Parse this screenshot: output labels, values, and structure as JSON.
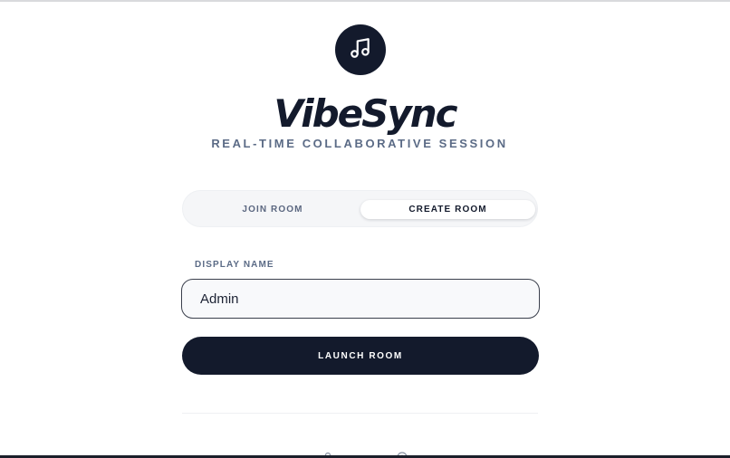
{
  "app": {
    "name": "VibeSync",
    "tagline": "REAL-TIME COLLABORATIVE SESSION",
    "logo_icon": "music-note-icon"
  },
  "tabs": [
    {
      "label": "JOIN ROOM",
      "active": false
    },
    {
      "label": "CREATE ROOM",
      "active": true
    }
  ],
  "form": {
    "display_name_label": "DISPLAY NAME",
    "display_name_value": "Admin"
  },
  "actions": {
    "launch_label": "LAUNCH ROOM"
  },
  "footer": {
    "icons": [
      "user-icon",
      "info-icon"
    ]
  },
  "colors": {
    "primary": "#131a2c",
    "muted": "#5b6b86",
    "tab_track": "#f5f6f8"
  }
}
